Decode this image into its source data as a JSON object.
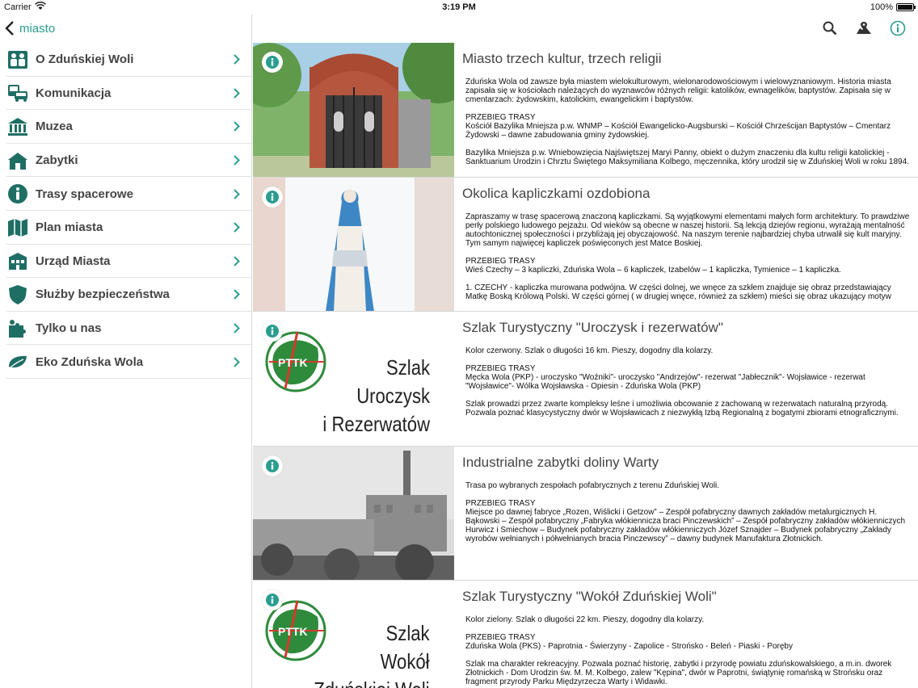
{
  "status": {
    "carrier": "Carrier",
    "time": "3:19 PM",
    "battery": "100%"
  },
  "sidebar": {
    "back_label": "miasto",
    "items": [
      {
        "label": "O Zduńskiej Woli",
        "icon": "people-icon"
      },
      {
        "label": "Komunikacja",
        "icon": "transport-icon"
      },
      {
        "label": "Muzea",
        "icon": "museum-icon"
      },
      {
        "label": "Zabytki",
        "icon": "monument-icon"
      },
      {
        "label": "Trasy spacerowe",
        "icon": "info-icon"
      },
      {
        "label": "Plan miasta",
        "icon": "map-icon"
      },
      {
        "label": "Urząd Miasta",
        "icon": "city-hall-icon"
      },
      {
        "label": "Służby bezpieczeństwa",
        "icon": "shield-icon"
      },
      {
        "label": "Tylko u nas",
        "icon": "puzzle-icon"
      },
      {
        "label": "Eko Zduńska Wola",
        "icon": "leaf-icon"
      }
    ]
  },
  "toolbar": {
    "search": "search-icon",
    "map": "map-pin-icon",
    "info": "info-icon"
  },
  "colors": {
    "accent": "#2a9d8f",
    "icon_dark": "#1f6e64",
    "pttk_green": "#2e8b3c",
    "pttk_red": "#d33a2c"
  },
  "routes": [
    {
      "title": "Miasto trzech kultur, trzech religii",
      "body": "Zduńska Wola od zawsze była miastem wielokulturowym, wielonarodowościowym i wielowyznaniowym. Historia miasta zapisała się w kościołach należących do wyznawców różnych religii: katolików, ewnagelików, baptystów. Zapisała się w cmentarzach: żydowskim, katolickim, ewangelickim i baptystów.\n\nPRZEBIEG TRASY\nKościół Bazylika Mniejsza p.w. WNMP – Kościół Ewangelicko-Augsburski – Kościół Chrześcijan Baptystów – Cmentarz Żydowski – dawne zabudowania gminy żydowskiej.\n\nBazylika Mniejsza p.w. Wniebowzięcia Najświętszej Maryi Panny, obiekt o dużym znaczeniu dla kultu religii katolickiej - Sanktuarium Urodzin i Chrztu Świętego Maksymiliana Kolbego, męczennika, który urodził się w Zduńskiej Woli w roku 1894."
    },
    {
      "title": "Okolica kapliczkami ozdobiona",
      "body": "Zapraszamy w trasę spacerową znaczoną kapliczkami. Są wyjątkowymi elementami małych form architektury. To prawdziwe perły polskiego ludowego pejzażu. Od wieków są obecne w naszej historii. Są lekcją dziejów regionu, wyrażają mentalność autochtonicznej społeczności i przybliżają jej obyczajowość. Na naszym terenie najbardziej chyba utrwalił się kult maryjny. Tym samym najwięcej kapliczek poświęconych jest Matce Boskiej.\n\nPRZEBIEG TRASY\nWieś Czechy – 3 kapliczki, Zduńska Wola – 6 kapliczek, Izabelów – 1 kapliczka, Tymienice – 1 kapliczka.\n\n1. CZECHY - kapliczka murowana podwójna. W części dolnej, we wnęce za szkłem znajduje się obraz przedstawiający Matkę Boską Królową Polski. W części górnej ( w drugiej wnęce, również za szkłem) mieści się obraz ukazujący motyw"
    },
    {
      "title": "Szlak Turystyczny \"Uroczysk i rezerwatów\"",
      "body": "Kolor czerwony. Szlak o długości 16 km. Pieszy, dogodny dla kolarzy.\n\nPRZEBIEG TRASY\nMęcka Wola (PKP) - uroczysko \"Woźniki\"- uroczysko \"Andrzejów\"- rezerwat \"Jabłecznik\"- Wojsławice - rezerwat \"Wojsławice\"- Wólka Wojsławska - Opiesin - Zduńska Wola (PKP)\n\nSzlak prowadzi przez zwarte kompleksy leśne i umożliwia obcowanie z zachowaną w rezerwatach naturalną przyrodą. Pozwala poznać klasycystyczny dwór w Wojsławicach z niezwykłą Izbą Regionalną z bogatymi zbiorami etnograficznymi.",
      "sign": [
        "Szlak",
        "Uroczysk",
        "i Rezerwatów"
      ]
    },
    {
      "title": "Industrialne zabytki doliny Warty",
      "body": "Trasa po wybranych zespołach pofabrycznych z terenu Zduńskiej Woli.\n\nPRZEBIEG TRASY\nMiejsce po dawnej fabryce „Rozen, Wiślicki i Getzow” – Zespół pofabryczny dawnych zakładów metalurgicznych H. Bąkowski – Zespół pofabryczny „Fabryka włókiennicza braci Pinczewskich” – Zespół pofabryczny zakładów włókienniczych Hurwicz i Smiechow – Budynek pofabryczny zakładów włókienniczych Józef Sznajder –  Budynek pofabryczny „Zakłady wyrobów wełnianych i półwełnianych bracia Pinczewscy” – dawny budynek Manufaktura Złotnickich."
    },
    {
      "title": "Szlak Turystyczny \"Wokół Zduńskiej Woli\"",
      "body": "Kolor zielony. Szlak o długości 22 km. Pieszy, dogodny dla kolarzy.\n\nPRZEBIEG TRASY\nZduńska Wola (PKS) - Paprotnia - Świerzyny - Zapolice - Strońsko - Beleń - Piaski - Poręby\n\nSzlak ma charakter rekreacyjny. Pozwala poznać historię, zabytki i przyrodę powiatu zduńskowalskiego, a m.in. dworek Złotnickich - Dom Urodzin św. M. M. Kolbego, zalew \"Kępina\", dwór w Paprotni, świątynię romańską w Strońsku oraz fragment przyrody Parku Międzyrzecza Warty i Widawki.",
      "sign": [
        "Szlak",
        "Wokół",
        "Zduńskiej Woli"
      ]
    }
  ],
  "pttk_label": "PTTK"
}
